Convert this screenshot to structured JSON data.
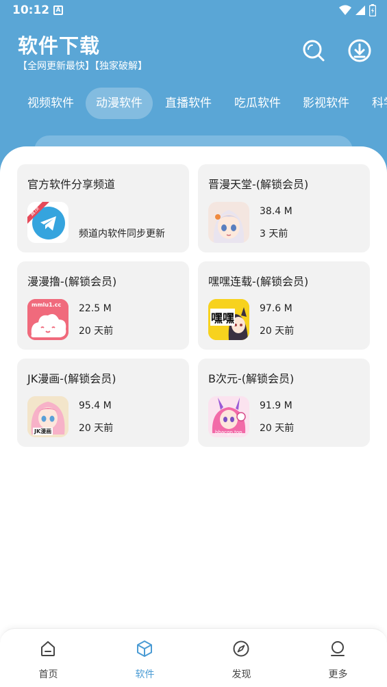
{
  "status_bar": {
    "time": "10:12",
    "notif_glyph": "A"
  },
  "header": {
    "title": "软件下载",
    "subtitle": "【全网更新最快】【独家破解】",
    "search_icon": "search-icon",
    "download_icon": "download-icon"
  },
  "tabs": [
    {
      "label": "视频软件",
      "active": false
    },
    {
      "label": "动漫软件",
      "active": true
    },
    {
      "label": "直播软件",
      "active": false
    },
    {
      "label": "吃瓜软件",
      "active": false
    },
    {
      "label": "影视软件",
      "active": false
    },
    {
      "label": "科学",
      "active": false
    }
  ],
  "cards": [
    {
      "title": "官方软件分享频道",
      "desc": "频道内软件同步更新",
      "icon": "telegram-icon",
      "badge": "置顶"
    },
    {
      "title": "晋漫天堂-(解锁会员)",
      "size": "38.4 M",
      "date": "3 天前",
      "icon": "anime-girl-icon"
    },
    {
      "title": "漫漫撸-(解锁会员)",
      "size": "22.5 M",
      "date": "20 天前",
      "icon": "cloud-face-icon",
      "icon_text": "mmlu1.cc"
    },
    {
      "title": "嘿嘿连载-(解锁会员)",
      "size": "97.6 M",
      "date": "20 天前",
      "icon": "heihei-icon",
      "icon_text": "嘿嘿"
    },
    {
      "title": "JK漫画-(解锁会员)",
      "size": "95.4 M",
      "date": "20 天前",
      "icon": "jk-girl-icon",
      "icon_text": "JK漫画"
    },
    {
      "title": "B次元-(解锁会员)",
      "size": "91.9 M",
      "date": "20 天前",
      "icon": "bunny-girl-icon",
      "icon_text": "bbacgn.top"
    }
  ],
  "bottom_nav": [
    {
      "label": "首页",
      "icon": "home-icon",
      "active": false
    },
    {
      "label": "软件",
      "icon": "cube-icon",
      "active": true
    },
    {
      "label": "发现",
      "icon": "compass-icon",
      "active": false
    },
    {
      "label": "更多",
      "icon": "user-icon",
      "active": false
    }
  ],
  "colors": {
    "header": "#5aa6d6",
    "accent": "#4a9bd4",
    "card_bg": "#f2f2f2"
  }
}
